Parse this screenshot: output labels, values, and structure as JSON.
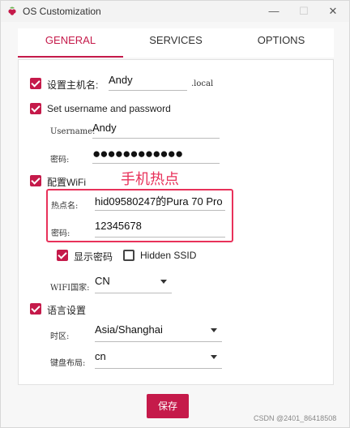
{
  "window": {
    "title": "OS Customization"
  },
  "tabs": [
    "GENERAL",
    "SERVICES",
    "OPTIONS"
  ],
  "hostname": {
    "label": "设置主机名:",
    "value": "Andy",
    "suffix": ".local"
  },
  "user": {
    "label": "Set username and password",
    "username_label": "Username:",
    "username_value": "Andy",
    "password_label": "密码:",
    "password_masked": "●●●●●●●●●●●●"
  },
  "wifi": {
    "label": "配置WiFi",
    "ssid_label": "热点名:",
    "ssid_value": "hid09580247的Pura 70 Pro",
    "password_label": "密码:",
    "password_value": "12345678",
    "show_password_label": "显示密码",
    "hidden_ssid_label": "Hidden SSID",
    "country_label": "WIFI国家:",
    "country_value": "CN"
  },
  "locale": {
    "label": "语言设置",
    "timezone_label": "时区:",
    "timezone_value": "Asia/Shanghai",
    "keyboard_label": "键盘布局:",
    "keyboard_value": "cn"
  },
  "annotation": "手机热点",
  "save_label": "保存",
  "watermark": "CSDN @2401_86418508",
  "colors": {
    "accent": "#c51a4a",
    "annotation": "#e8315a"
  },
  "icons": {
    "app": "raspberry-icon",
    "minimize": "minimize-icon",
    "maximize": "maximize-icon",
    "close": "close-icon"
  }
}
